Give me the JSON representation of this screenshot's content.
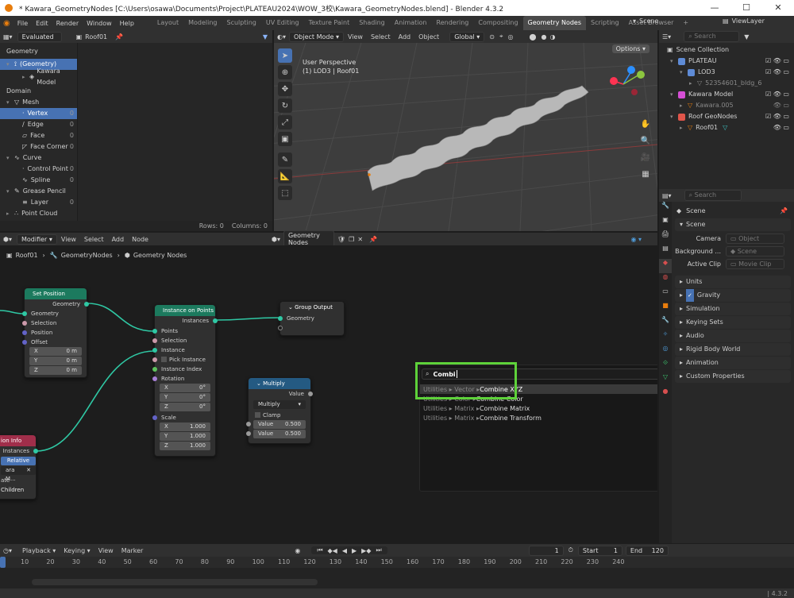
{
  "window": {
    "title": "* Kawara_GeometryNodes [C:\\Users\\osawa\\Documents\\Project\\PLATEAU2024\\WOW_3校\\Kawara_GeometryNodes.blend] - Blender 4.3.2"
  },
  "menu": [
    "File",
    "Edit",
    "Render",
    "Window",
    "Help"
  ],
  "workspaces": [
    "Layout",
    "Modeling",
    "Sculpting",
    "UV Editing",
    "Texture Paint",
    "Shading",
    "Animation",
    "Rendering",
    "Compositing",
    "Geometry Nodes",
    "Scripting",
    "Asset Browser"
  ],
  "active_workspace": "Geometry Nodes",
  "scene_field": "Scene",
  "viewlayer_field": "ViewLayer",
  "spreadsheet": {
    "mode": "Evaluated",
    "object": "Roof01",
    "geometry_label": "Geometry",
    "geometry_item": "(Geometry)",
    "model_item": "Kawara Model",
    "domain_label": "Domain",
    "mesh_label": "Mesh",
    "mesh_items": [
      {
        "label": "Vertex",
        "count": "0"
      },
      {
        "label": "Edge",
        "count": "0"
      },
      {
        "label": "Face",
        "count": "0"
      },
      {
        "label": "Face Corner",
        "count": "0"
      }
    ],
    "curve_label": "Curve",
    "curve_items": [
      {
        "label": "Control Point",
        "count": "0"
      },
      {
        "label": "Spline",
        "count": "0"
      }
    ],
    "gp_label": "Grease Pencil",
    "gp_items": [
      {
        "label": "Layer",
        "count": "0"
      }
    ],
    "pc_label": "Point Cloud",
    "rows": "Rows: 0",
    "columns": "Columns: 0"
  },
  "viewport": {
    "mode": "Object Mode",
    "menus": [
      "View",
      "Select",
      "Add",
      "Object"
    ],
    "orientation": "Global",
    "options": "Options",
    "perspective": "User Perspective",
    "context": "(1) LOD3 | Roof01"
  },
  "outliner": {
    "search_placeholder": "Search",
    "root": "Scene Collection",
    "items": [
      "PLATEAU",
      "LOD3",
      "52354601_bldg_6",
      "Kawara Model",
      "Kawara.005",
      "Roof GeoNodes",
      "Roof01"
    ]
  },
  "properties": {
    "search_placeholder": "Search",
    "scene_title": "Scene",
    "section_scene": "Scene",
    "camera_label": "Camera",
    "camera_value": "Object",
    "background_label": "Background ...",
    "background_value": "Scene",
    "clip_label": "Active Clip",
    "clip_value": "Movie Clip",
    "sections": [
      "Units",
      "Gravity",
      "Simulation",
      "Keying Sets",
      "Audio",
      "Rigid Body World",
      "Animation",
      "Custom Properties"
    ]
  },
  "node_editor": {
    "type": "Modifier",
    "menus": [
      "View",
      "Select",
      "Add",
      "Node"
    ],
    "tree_name": "Geometry Nodes",
    "breadcrumb": [
      "Roof01",
      "GeometryNodes",
      "Geometry Nodes"
    ],
    "set_position": {
      "title": "Set Position",
      "out": "Geometry",
      "inputs": [
        "Geometry",
        "Selection",
        "Position",
        "Offset"
      ],
      "x": "0 m",
      "y": "0 m",
      "z": "0 m"
    },
    "instance_on_points": {
      "title": "Instance on Points",
      "out": "Instances",
      "inputs": [
        "Points",
        "Selection",
        "Instance"
      ],
      "pick": "Pick Instance",
      "index": "Instance Index",
      "rotation": "Rotation",
      "rx": "0°",
      "ry": "0°",
      "rz": "0°",
      "scale": "Scale",
      "sx": "1.000",
      "sy": "1.000",
      "sz": "1.000"
    },
    "group_output": {
      "title": "Group Output",
      "input": "Geometry"
    },
    "multiply": {
      "title": "Multiply",
      "out": "Value",
      "op": "Multiply",
      "clamp": "Clamp",
      "v1_label": "Value",
      "v1": "0.500",
      "v2_label": "Value",
      "v2": "0.500"
    },
    "object_info": {
      "title": "ion Info",
      "out": "Instances",
      "relative": "Relative",
      "obj": "ara M...",
      "sep": "ate Children",
      "reset": "Children"
    },
    "axis": {
      "x": "X",
      "y": "Y",
      "z": "Z"
    }
  },
  "search": {
    "query": "Combi",
    "results": [
      {
        "path": "Utilities ▸ Vector ▸ ",
        "name": "Combine XYZ"
      },
      {
        "path": "Utilities ▸ Color ▸ ",
        "name": "Combine Color"
      },
      {
        "path": "Utilities ▸ Matrix ▸ ",
        "name": "Combine Matrix"
      },
      {
        "path": "Utilities ▸ Matrix ▸ ",
        "name": "Combine Transform"
      }
    ],
    "highlight_color": "#5ed23a"
  },
  "timeline": {
    "menus": [
      "Playback",
      "Keying",
      "View",
      "Marker"
    ],
    "frame": "1",
    "start_label": "Start",
    "start": "1",
    "end_label": "End",
    "end": "120",
    "ticks": [
      "10",
      "20",
      "30",
      "40",
      "50",
      "60",
      "70",
      "80",
      "90",
      "100",
      "110",
      "120",
      "130",
      "140",
      "150",
      "160",
      "170",
      "180",
      "190",
      "200",
      "210",
      "220",
      "230",
      "240"
    ]
  },
  "status": {
    "version": "4.3.2"
  }
}
